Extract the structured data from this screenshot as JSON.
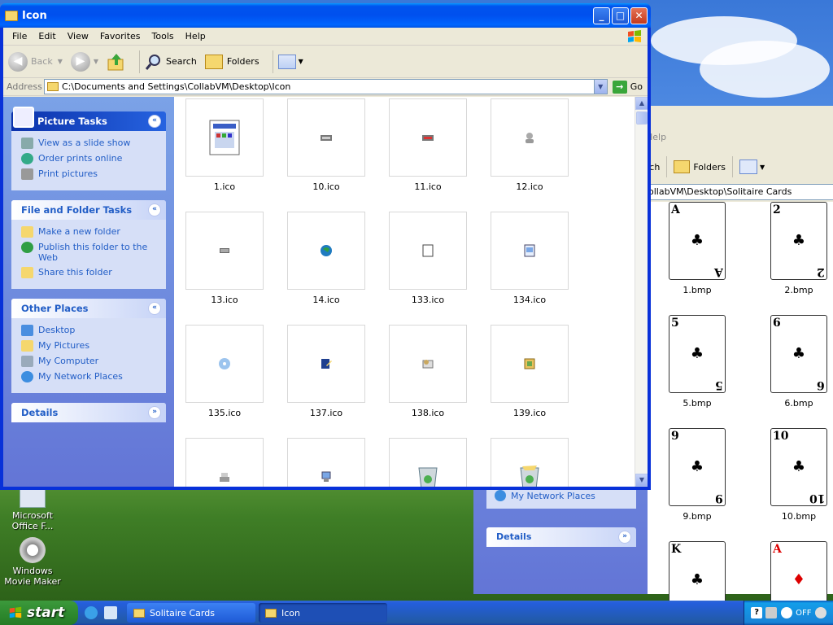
{
  "desktop": {
    "icons": [
      {
        "label": "Microsoft Office F..."
      },
      {
        "label": "Windows Movie Maker"
      }
    ]
  },
  "back_window": {
    "title": "Solitaire Cards",
    "menu_help": "Help",
    "toolbar": {
      "search_partial": "rch",
      "folders": "Folders"
    },
    "address_partial": "ollabVM\\Desktop\\Solitaire Cards",
    "other_places_item": "My Network Places",
    "details_header": "Details",
    "cards": [
      {
        "label": "1.bmp",
        "rank": "A",
        "suit": "♣",
        "color": "black"
      },
      {
        "label": "2.bmp",
        "rank": "2",
        "suit": "♣",
        "color": "black"
      },
      {
        "label": "5.bmp",
        "rank": "5",
        "suit": "♣",
        "color": "black"
      },
      {
        "label": "6.bmp",
        "rank": "6",
        "suit": "♣",
        "color": "black"
      },
      {
        "label": "9.bmp",
        "rank": "9",
        "suit": "♣",
        "color": "black"
      },
      {
        "label": "10.bmp",
        "rank": "10",
        "suit": "♣",
        "color": "black"
      },
      {
        "label": "",
        "rank": "K",
        "suit": "♣",
        "color": "black"
      },
      {
        "label": "",
        "rank": "A",
        "suit": "♦",
        "color": "red"
      }
    ]
  },
  "window": {
    "title": "Icon",
    "menu": [
      "File",
      "Edit",
      "View",
      "Favorites",
      "Tools",
      "Help"
    ],
    "toolbar": {
      "back": "Back",
      "search": "Search",
      "folders": "Folders"
    },
    "address": {
      "label": "Address",
      "value": "C:\\Documents and Settings\\CollabVM\\Desktop\\Icon",
      "go": "Go"
    },
    "taskpane": {
      "picture_tasks": {
        "header": "Picture Tasks",
        "items": [
          "View as a slide show",
          "Order prints online",
          "Print pictures"
        ]
      },
      "file_folder_tasks": {
        "header": "File and Folder Tasks",
        "items": [
          "Make a new folder",
          "Publish this folder to the Web",
          "Share this folder"
        ]
      },
      "other_places": {
        "header": "Other Places",
        "items": [
          "Desktop",
          "My Pictures",
          "My Computer",
          "My Network Places"
        ]
      },
      "details": {
        "header": "Details"
      }
    },
    "files": [
      {
        "name": "1.ico",
        "icon": "window-icon"
      },
      {
        "name": "10.ico",
        "icon": "drive-icon"
      },
      {
        "name": "11.ico",
        "icon": "drive-red-icon"
      },
      {
        "name": "12.ico",
        "icon": "user-icon"
      },
      {
        "name": "13.ico",
        "icon": "chip-icon"
      },
      {
        "name": "14.ico",
        "icon": "globe-icon"
      },
      {
        "name": "133.ico",
        "icon": "page-icon"
      },
      {
        "name": "134.ico",
        "icon": "doc-icon"
      },
      {
        "name": "135.ico",
        "icon": "cd-icon"
      },
      {
        "name": "137.ico",
        "icon": "edit-icon"
      },
      {
        "name": "138.ico",
        "icon": "mail-icon"
      },
      {
        "name": "139.ico",
        "icon": "picture-icon"
      },
      {
        "name": "",
        "icon": "scanner-icon"
      },
      {
        "name": "",
        "icon": "network-icon"
      },
      {
        "name": "",
        "icon": "recycle-empty-icon"
      },
      {
        "name": "",
        "icon": "recycle-full-icon"
      }
    ]
  },
  "taskbar": {
    "start": "start",
    "tasks": [
      {
        "label": "Solitaire Cards",
        "active": false
      },
      {
        "label": "Icon",
        "active": true
      }
    ],
    "tray_text": "OFF"
  },
  "colors": {
    "title_blue": "#0054e3",
    "task_link": "#215dc6",
    "start_green": "#2f8a2f"
  }
}
